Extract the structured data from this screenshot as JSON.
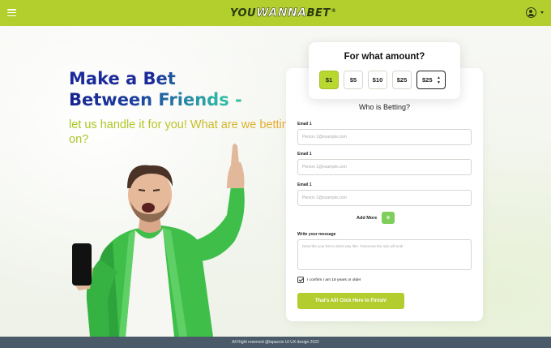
{
  "header": {
    "logo": {
      "part1": "YOU",
      "part2": "WANNA",
      "part3": "BET",
      "mark": "®"
    },
    "menu_icon": "hamburger-icon",
    "user_icon": "user-circle-icon",
    "brand_color": "#b3cf2e"
  },
  "hero": {
    "headline_line1": "Make a Bet",
    "headline_line2": "Between Friends -",
    "subheadline": "let us handle it for you! What are we betting on?"
  },
  "amount": {
    "title": "For what amount?",
    "options": [
      "$1",
      "$5",
      "$10",
      "$25"
    ],
    "selected": "$1",
    "select_value": "$25"
  },
  "form": {
    "title": "Who is Betting?",
    "emails": [
      {
        "label": "Email 1",
        "placeholder": "Person 1@example.com"
      },
      {
        "label": "Email 1",
        "placeholder": "Person 1@example.com"
      },
      {
        "label": "Email 1",
        "placeholder": "Person 1@example.com"
      }
    ],
    "add_more": "Add More",
    "add_icon": "+",
    "message_label": "Write your message",
    "message_placeholder": "Describe your bet in short way like: Tomorrow the rain will end!",
    "confirm_label": "I confirm I am 18 years or older",
    "confirm_checked": true,
    "submit": "That's All! Click Here to Finish!"
  },
  "footer": {
    "text": "All Right reserved @lapaccio UI UX design 2022"
  }
}
